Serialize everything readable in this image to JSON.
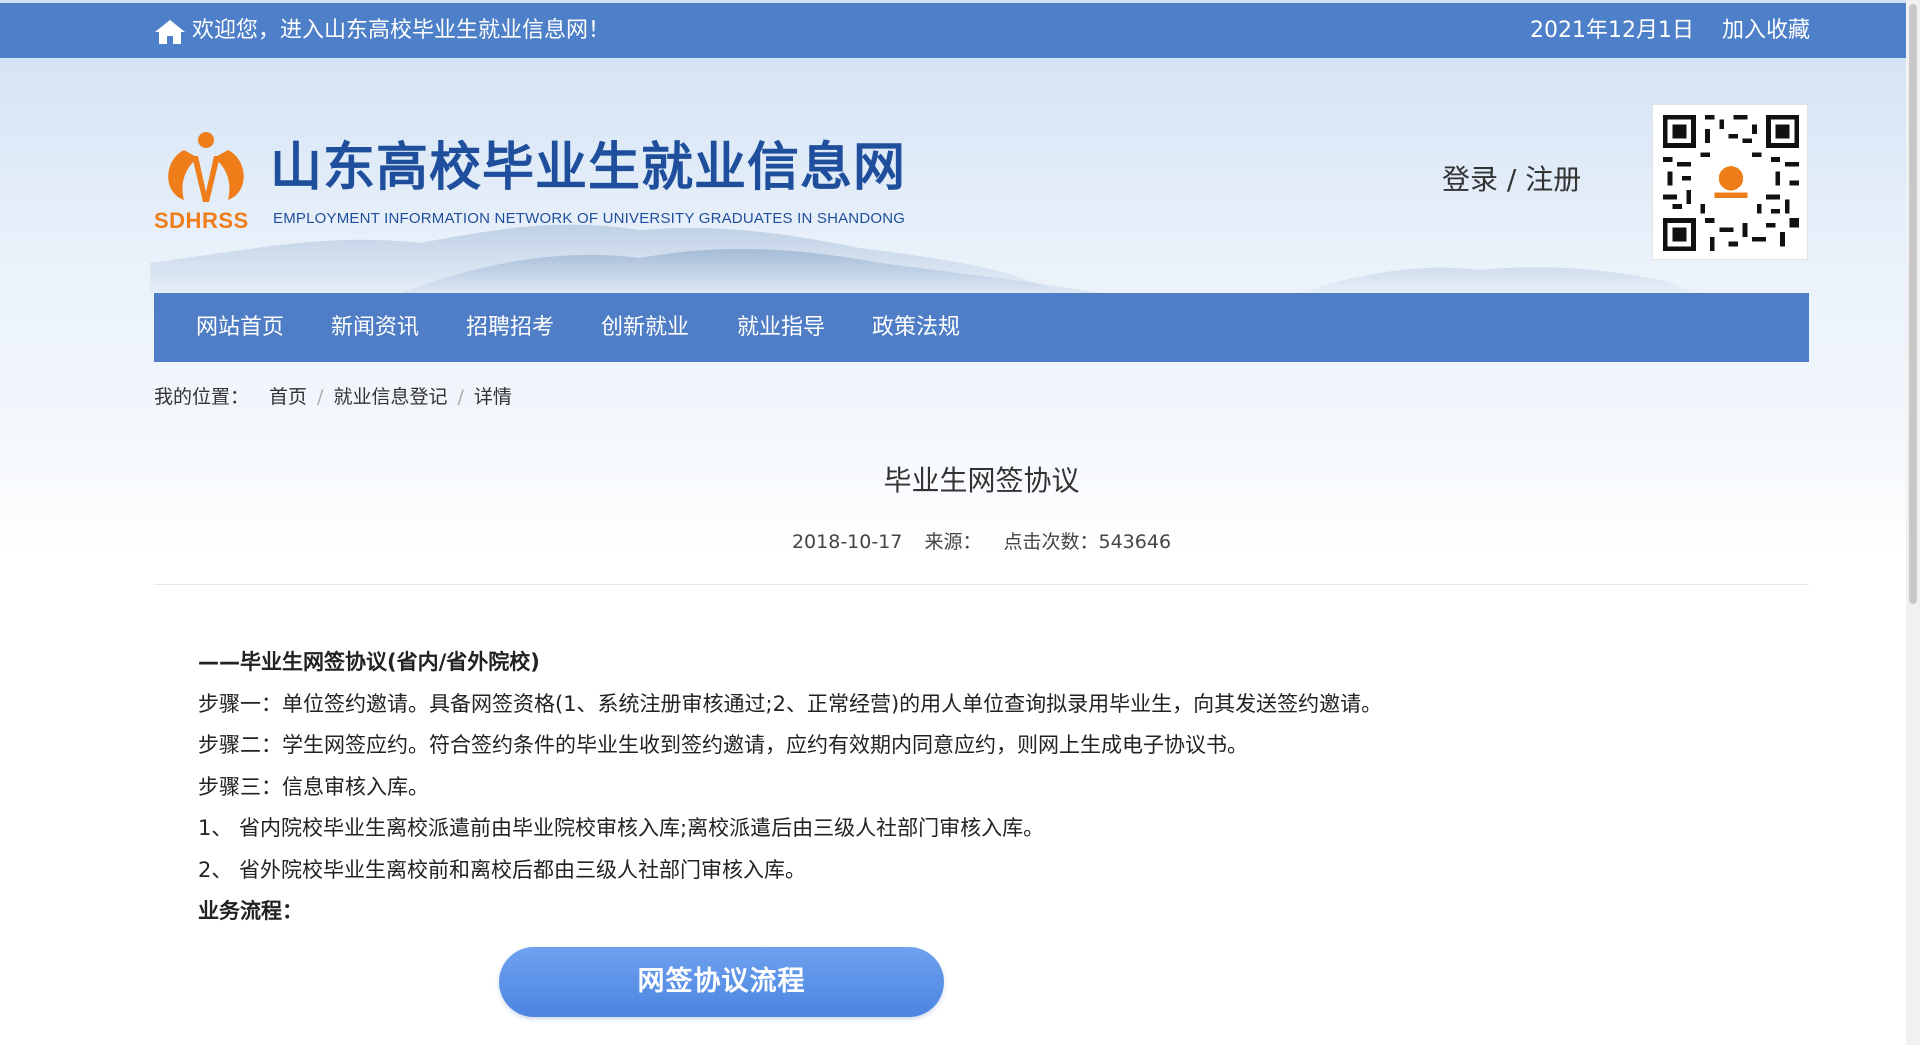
{
  "topbar": {
    "welcome": "欢迎您，进入山东高校毕业生就业信息网！",
    "date": "2021年12月1日",
    "favorite": "加入收藏"
  },
  "header": {
    "title": "山东高校毕业生就业信息网",
    "subtitle": "EMPLOYMENT INFORMATION NETWORK OF UNIVERSITY GRADUATES IN SHANDONG",
    "logo_text": "SDHRSS",
    "login": "登录 / 注册"
  },
  "nav": {
    "items": [
      "网站首页",
      "新闻资讯",
      "招聘招考",
      "创新就业",
      "就业指导",
      "政策法规"
    ]
  },
  "breadcrumb": {
    "label": "我的位置：",
    "items": [
      "首页",
      "就业信息登记",
      "详情"
    ],
    "separator": "/"
  },
  "article": {
    "title": "毕业生网签协议",
    "date": "2018-10-17",
    "source": "来源：",
    "clicks": "点击次数：543646",
    "lines": [
      "——毕业生网签协议(省内/省外院校)",
      "步骤一：单位签约邀请。具备网签资格(1、系统注册审核通过;2、正常经营)的用人单位查询拟录用毕业生，向其发送签约邀请。",
      "步骤二：学生网签应约。符合签约条件的毕业生收到签约邀请，应约有效期内同意应约，则网上生成电子协议书。",
      "步骤三：信息审核入库。",
      "1、 省内院校毕业生离校派遣前由毕业院校审核入库;离校派遣后由三级人社部门审核入库。",
      "2、 省外院校毕业生离校前和离校后都由三级人社部门审核入库。",
      "业务流程："
    ],
    "flow_button": "网签协议流程"
  },
  "colors": {
    "topbar": "#4e7fc9",
    "nav": "#4f7ec6",
    "title_blue": "#1f4f9c",
    "logo_orange": "#ef7d1a",
    "button": "#5b93e8"
  }
}
